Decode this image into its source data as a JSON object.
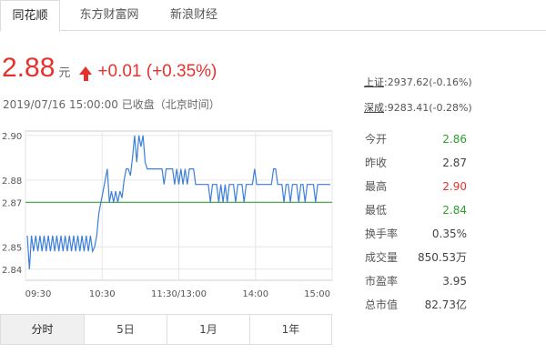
{
  "top_tabs": [
    {
      "label": "同花顺",
      "active": true
    },
    {
      "label": "东方财富网",
      "active": false
    },
    {
      "label": "新浪财经",
      "active": false
    }
  ],
  "quote": {
    "price": "2.88",
    "unit": "元",
    "change": "+0.01 (+0.35%)",
    "timestamp": "2019/07/16 15:00:00  已收盘（北京时间）",
    "up_color": "#e5322d",
    "down_color": "#2e9e2e"
  },
  "indices": [
    {
      "name": "上证",
      "value": ":2937.62(-0.16%)"
    },
    {
      "name": "深成",
      "value": ":9283.41(-0.28%)"
    }
  ],
  "stats": [
    {
      "label": "今开",
      "value": "2.86",
      "color": "#2e9e2e"
    },
    {
      "label": "昨收",
      "value": "2.87",
      "color": "#444444"
    },
    {
      "label": "最高",
      "value": "2.90",
      "color": "#e5322d"
    },
    {
      "label": "最低",
      "value": "2.84",
      "color": "#2e9e2e"
    },
    {
      "label": "换手率",
      "value": "0.35%",
      "color": "#444444"
    },
    {
      "label": "成交量",
      "value": "850.53万",
      "color": "#444444"
    },
    {
      "label": "市盈率",
      "value": "3.95",
      "color": "#444444"
    },
    {
      "label": "总市值",
      "value": "82.73亿",
      "color": "#444444"
    }
  ],
  "chart_data": {
    "type": "line",
    "title": "",
    "xlabel": "",
    "ylabel": "",
    "y_ticks": [
      "2.90",
      "2.88",
      "2.87",
      "2.85",
      "2.84"
    ],
    "x_ticks": [
      "09:30",
      "10:30",
      "11:30/13:00",
      "14:00",
      "15:00"
    ],
    "ylim": [
      2.835,
      2.902
    ],
    "baseline": 2.87,
    "baseline_color": "#3aa63a",
    "line_color": "#3d7fd8",
    "grid": true,
    "series": [
      {
        "values": [
          2.855,
          2.84,
          2.855,
          2.848,
          2.855,
          2.848,
          2.855,
          2.848,
          2.855,
          2.848,
          2.855,
          2.848,
          2.855,
          2.848,
          2.855,
          2.848,
          2.855,
          2.848,
          2.855,
          2.848,
          2.855,
          2.848,
          2.855,
          2.848,
          2.855,
          2.848,
          2.855,
          2.848,
          2.855,
          2.848,
          2.855,
          2.848,
          2.85,
          2.855,
          2.865,
          2.87,
          2.875,
          2.88,
          2.885,
          2.87,
          2.875,
          2.87,
          2.875,
          2.87,
          2.875,
          2.872,
          2.88,
          2.885,
          2.885,
          2.882,
          2.89,
          2.9,
          2.888,
          2.9,
          2.895,
          2.9,
          2.888,
          2.885,
          2.885,
          2.885,
          2.885,
          2.885,
          2.885,
          2.885,
          2.885,
          2.878,
          2.885,
          2.885,
          2.885,
          2.885,
          2.878,
          2.885,
          2.878,
          2.885,
          2.878,
          2.885,
          2.878,
          2.885,
          2.885,
          2.885,
          2.878,
          2.878,
          2.878,
          2.878,
          2.878,
          2.878,
          2.878,
          2.87,
          2.878,
          2.878,
          2.878,
          2.87,
          2.878,
          2.87,
          2.878,
          2.87,
          2.878,
          2.878,
          2.878,
          2.87,
          2.878,
          2.878,
          2.878,
          2.87,
          2.878,
          2.878,
          2.878,
          2.878,
          2.885,
          2.878,
          2.878,
          2.878,
          2.878,
          2.878,
          2.878,
          2.878,
          2.878,
          2.885,
          2.885,
          2.878,
          2.878,
          2.878,
          2.87,
          2.878,
          2.878,
          2.87,
          2.878,
          2.878,
          2.878,
          2.87,
          2.878,
          2.878,
          2.87,
          2.878,
          2.878,
          2.878,
          2.878,
          2.87,
          2.878,
          2.878,
          2.878,
          2.878,
          2.878,
          2.878,
          2.878
        ]
      }
    ]
  },
  "range_tabs": [
    {
      "label": "分时",
      "active": true
    },
    {
      "label": "5日",
      "active": false
    },
    {
      "label": "1月",
      "active": false
    },
    {
      "label": "1年",
      "active": false
    }
  ]
}
